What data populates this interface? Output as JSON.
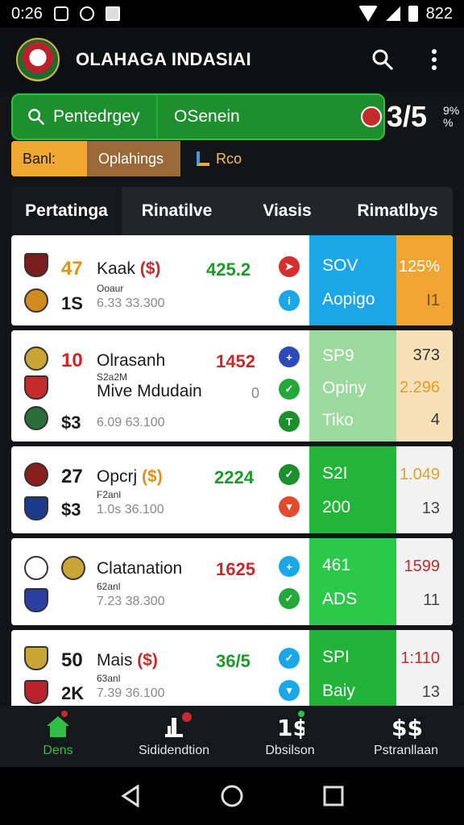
{
  "status_bar": {
    "time": "0:26",
    "battery": "822"
  },
  "app": {
    "title": "OLAHAGA INDASIAI"
  },
  "search": {
    "primary": "Pentedrgey",
    "secondary": "OSenein",
    "score": "3/5",
    "score_sub_1": "9%",
    "score_sub_2": "%"
  },
  "chips": [
    {
      "label": "Banl:"
    },
    {
      "label": "Oplahings"
    },
    {
      "label": "Rco"
    }
  ],
  "tabs": [
    {
      "label": "Pertatinga"
    },
    {
      "label": "Rinatilve"
    },
    {
      "label": "Viasis"
    },
    {
      "label": "Rimatlbys"
    }
  ],
  "matches": [
    {
      "num1": "47",
      "team": "Kaak",
      "paren": "($)",
      "odds": "425.2",
      "sub": "Ooaur",
      "num2": "1S",
      "time": "6.33 33.300",
      "panel_top": "SOV",
      "panel_bottom": "Aopigo",
      "side_top": "125%",
      "side_bottom": "I1",
      "panel_color": "#1ba6e6",
      "side_color": "#f0a432"
    },
    {
      "num1": "10",
      "team": "Olrasanh",
      "odds": "1452",
      "sub": "S2a2M",
      "team2": "Mive Mdudain",
      "zero": "0",
      "num2": "$3",
      "time": "6.09 63.100",
      "panel_top": "SP9",
      "panel_mid": "Opiny",
      "panel_bottom": "Tiko",
      "side_top": "373",
      "side_mid": "2.296",
      "side_bottom": "4",
      "panel_color": "#9bd99c",
      "side_color": "#f6e0b8"
    },
    {
      "num1": "27",
      "team": "Opcrj",
      "paren": "($)",
      "odds": "2224",
      "sub": "F2anl",
      "num2": "$3",
      "time": "1.0s 36.100",
      "panel_top": "S2I",
      "panel_bottom": "200",
      "side_top": "1.049",
      "side_bottom": "13",
      "panel_color": "#23b43a",
      "side_color": "#f2f2f2"
    },
    {
      "team": "Clatanation",
      "odds": "1625",
      "sub": "62anl",
      "time": "7.23 38.300",
      "panel_top": "461",
      "panel_bottom": "ADS",
      "side_top": "1599",
      "side_bottom": "11",
      "panel_color": "#2bc94a",
      "side_color": "#f2f2f2"
    },
    {
      "num1": "50",
      "team": "Mais",
      "paren": "($)",
      "odds": "36/5",
      "sub": "63anl",
      "num2": "2K",
      "time": "7.39 36.100",
      "panel_top": "SPI",
      "panel_bottom": "Baiy",
      "side_top": "1:110",
      "side_bottom": "13",
      "panel_color": "#22b43a",
      "side_color": "#f2f2f2"
    }
  ],
  "bottom_nav": [
    {
      "label": "Dens"
    },
    {
      "label": "Sididendtion"
    },
    {
      "label": "Dbsilson"
    },
    {
      "label": "Pstranllaan"
    }
  ],
  "colors": {
    "accent": "#2fbf43",
    "odds_green": "#1a9b2a",
    "odds_red": "#c62a2a"
  }
}
